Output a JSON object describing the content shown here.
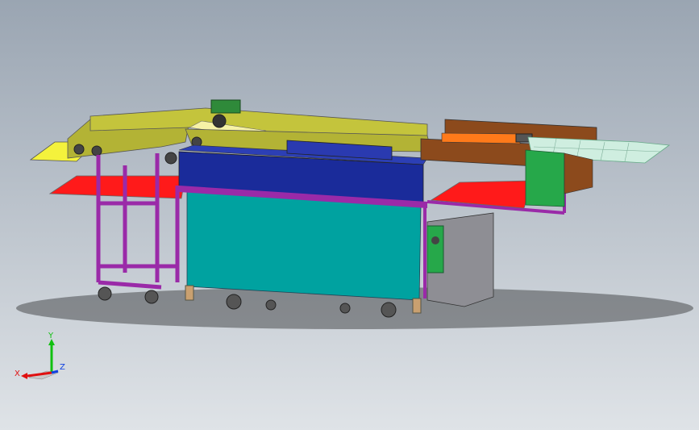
{
  "viewport": {
    "background_top": "#9aa5b2",
    "background_bottom": "#dfe3e7"
  },
  "model": {
    "colors": {
      "frame": "#9a2aa8",
      "conveyor_rail": "#b3b335",
      "tank_body": "#00a2a0",
      "blue_housing": "#1a2b9a",
      "red_tray": "#ff1a1a",
      "yellow_tray": "#f4f23c",
      "orange_block": "#ff7a1a",
      "brown_box": "#8c4a1c",
      "green_panel": "#26a84a",
      "control_box": "#8e8e94",
      "glass_grid": "#cfeee0",
      "motor": "#2f8a3a"
    }
  },
  "triad": {
    "y_label": "Y",
    "x_label": "X",
    "z_label": "Z",
    "y_color": "#10c010",
    "x_color": "#e01010",
    "z_color": "#1040e0"
  }
}
